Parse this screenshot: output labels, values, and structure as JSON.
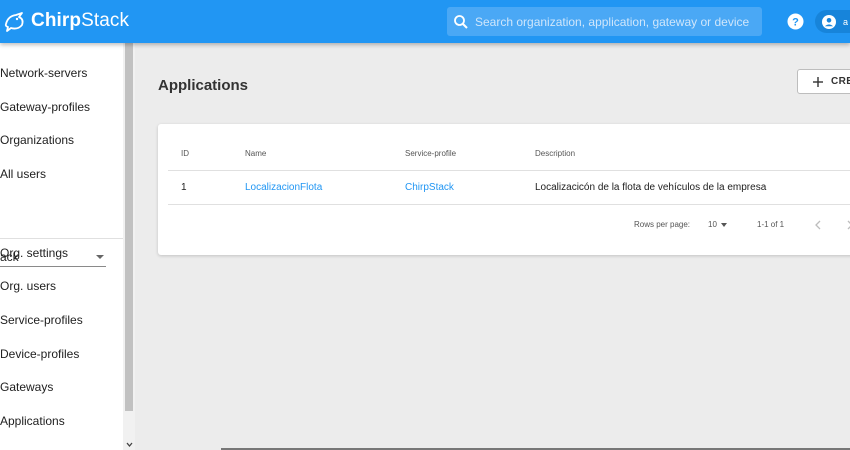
{
  "header": {
    "logo_text_bold": "Chirp",
    "logo_text_thin": "Stack",
    "search_placeholder": "Search organization, application, gateway or device",
    "user_label": "a"
  },
  "sidebar": {
    "items_top": [
      "Network-servers",
      "Gateway-profiles",
      "Organizations",
      "All users"
    ],
    "org_select_value": "ack",
    "items_org": [
      "Org. settings",
      "Org. users",
      "Service-profiles",
      "Device-profiles",
      "Gateways",
      "Applications"
    ]
  },
  "main": {
    "title": "Applications",
    "create_label": "CRE",
    "table": {
      "columns": [
        "ID",
        "Name",
        "Service-profile",
        "Description"
      ],
      "rows": [
        {
          "id": "1",
          "name": "LocalizacionFlota",
          "service_profile": "ChirpStack",
          "description": "Localizacicón de la flota de vehículos de la empresa"
        }
      ]
    },
    "pagination": {
      "rows_per_page_label": "Rows per page:",
      "rows_per_page_value": "10",
      "range": "1-1 of 1"
    }
  },
  "colors": {
    "primary": "#2196f3",
    "link": "#2196f3"
  },
  "icons": [
    "chirpstack-logo-icon",
    "search-icon",
    "help-icon",
    "account-icon",
    "chevron-down-icon",
    "plus-icon",
    "chevron-left-icon",
    "chevron-right-icon"
  ]
}
